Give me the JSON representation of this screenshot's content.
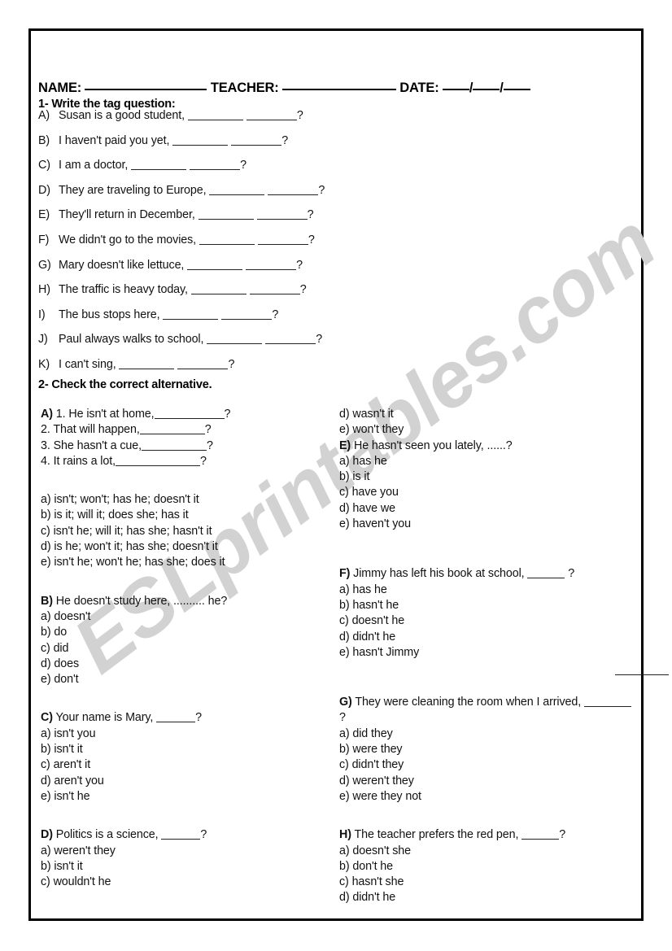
{
  "header": {
    "name_label": "NAME:",
    "teacher_label": "TEACHER:",
    "date_label": "DATE:",
    "date_sep": "/"
  },
  "watermark": {
    "text": "ESLprintables.com",
    "color": "#d2d2d2"
  },
  "section1": {
    "heading": "1-  Write the tag question:",
    "questions": [
      {
        "label": "A)",
        "text": "Susan is a good student,"
      },
      {
        "label": "B)",
        "text": "I haven't paid you yet,"
      },
      {
        "label": "C)",
        "text": "I am a doctor,"
      },
      {
        "label": "D)",
        "text": "They are traveling to Europe,"
      },
      {
        "label": "E)",
        "text": "They'll return in December,"
      },
      {
        "label": "F)",
        "text": "We didn't go to the movies,"
      },
      {
        "label": "G)",
        "text": "Mary doesn't like lettuce,"
      },
      {
        "label": "H)",
        "text": "The traffic is heavy today,"
      },
      {
        "label": "I)",
        "text": "The bus stops here,"
      },
      {
        "label": "J)",
        "text": "Paul always walks to school,"
      },
      {
        "label": "K)",
        "text": "I can't sing,"
      }
    ],
    "question_mark": "?"
  },
  "section2": {
    "heading": "2-  Check the correct alternative.",
    "left_column": {
      "A": {
        "label": "A)",
        "stems": [
          {
            "num": "1.",
            "text": "He isn't at home,"
          },
          {
            "num": "2.",
            "text": "That will happen,"
          },
          {
            "num": "3.",
            "text": "She hasn't a cue,"
          },
          {
            "num": "4.",
            "text": "It rains a lot,"
          }
        ],
        "options": [
          "a) isn't; won't; has he; doesn't it",
          "b) is it; will it; does she; has it",
          "c) isn't he; will it; has she; hasn't it",
          "d) is he; won't it; has she; doesn't it",
          "e) isn't he; won't he; has she; does it"
        ]
      },
      "B": {
        "label": "B)",
        "stem": "He doesn't study here, .......... he?",
        "options": [
          "a) doesn't",
          "b) do",
          "c) did",
          "d) does",
          "e) don't"
        ]
      },
      "C": {
        "label": "C)",
        "stem": "Your name is Mary,",
        "stem_end": "?",
        "options": [
          "a) isn't you",
          "b) isn't it",
          "c) aren't it",
          "d) aren't you",
          "e) isn't he"
        ]
      },
      "D": {
        "label": "D)",
        "stem": "Politics is a science,",
        "stem_end": "?",
        "options": [
          "a) weren't they",
          "b) isn't it",
          "c) wouldn't he"
        ]
      }
    },
    "right_column": {
      "A_continued": [
        "d) wasn't it",
        "e) won't they"
      ],
      "E": {
        "label": "E)",
        "stem": "He hasn't seen you lately, ......?",
        "options": [
          "a) has he",
          "b) is it",
          "c) have you",
          "d) have we",
          "e) haven't you"
        ]
      },
      "F": {
        "label": "F)",
        "stem": "Jimmy has left his book at school,",
        "stem_end": "?",
        "options": [
          "a) has he",
          "b) hasn't he",
          "c) doesn't he",
          "d) didn't he",
          "e) hasn't Jimmy"
        ]
      },
      "G": {
        "label": "G)",
        "stem": "They were cleaning the room when I arrived,",
        "stem_end": "?",
        "options": [
          "a) did they",
          "b) were they",
          "c) didn't they",
          "d) weren't they",
          "e) were they not"
        ]
      },
      "H": {
        "label": "H)",
        "stem": "The teacher prefers the red pen,",
        "stem_end": "?",
        "options": [
          "a) doesn't she",
          "b) don't he",
          "c) hasn't she",
          "d) didn't he"
        ]
      }
    }
  }
}
